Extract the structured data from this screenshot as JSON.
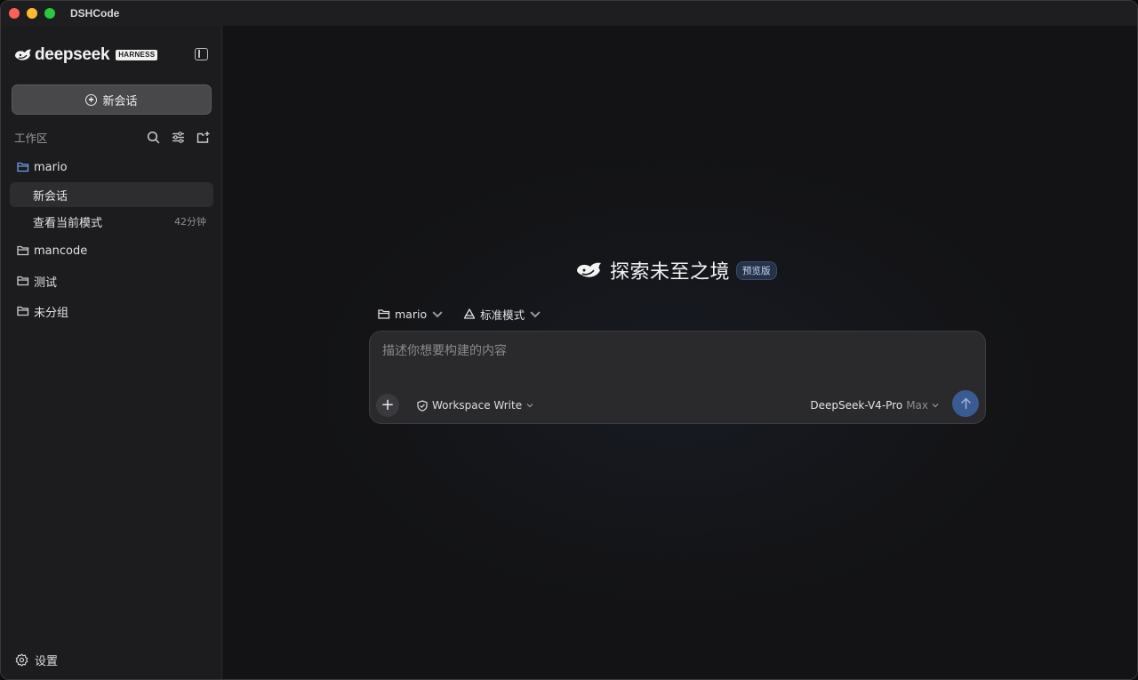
{
  "window": {
    "title": "DSHCode"
  },
  "brand": {
    "name": "deepseek",
    "tag": "HARNESS"
  },
  "sidebar": {
    "new_chat_label": "新会话",
    "workspace_label": "工作区",
    "folders": [
      {
        "name": "mario",
        "expanded": true,
        "sessions": [
          {
            "title": "新会话",
            "time": "",
            "active": true
          },
          {
            "title": "查看当前模式",
            "time": "42分钟",
            "active": false
          }
        ]
      },
      {
        "name": "mancode",
        "expanded": false
      },
      {
        "name": "测试",
        "expanded": false
      },
      {
        "name": "未分组",
        "expanded": false
      }
    ],
    "settings_label": "设置"
  },
  "main": {
    "hero_title": "探索未至之境",
    "hero_badge": "预览版",
    "context": {
      "project": "mario",
      "mode": "标准模式"
    },
    "composer": {
      "placeholder": "描述你想要构建的内容",
      "permission": "Workspace Write",
      "model": "DeepSeek-V4-Pro",
      "effort": "Max"
    }
  },
  "colors": {
    "accent": "#3a5a92",
    "active_folder_icon": "#6f9ce8",
    "sidebar_bg": "#1c1c1e",
    "main_bg": "#141518"
  },
  "icons": [
    "search-icon",
    "filter-icon",
    "new-folder-icon",
    "folder-icon",
    "gear-icon",
    "shield-icon",
    "chevron-down-icon",
    "arrow-up-icon",
    "plus-icon",
    "sidebar-toggle-icon",
    "recycle-icon",
    "whale-logo-icon"
  ]
}
